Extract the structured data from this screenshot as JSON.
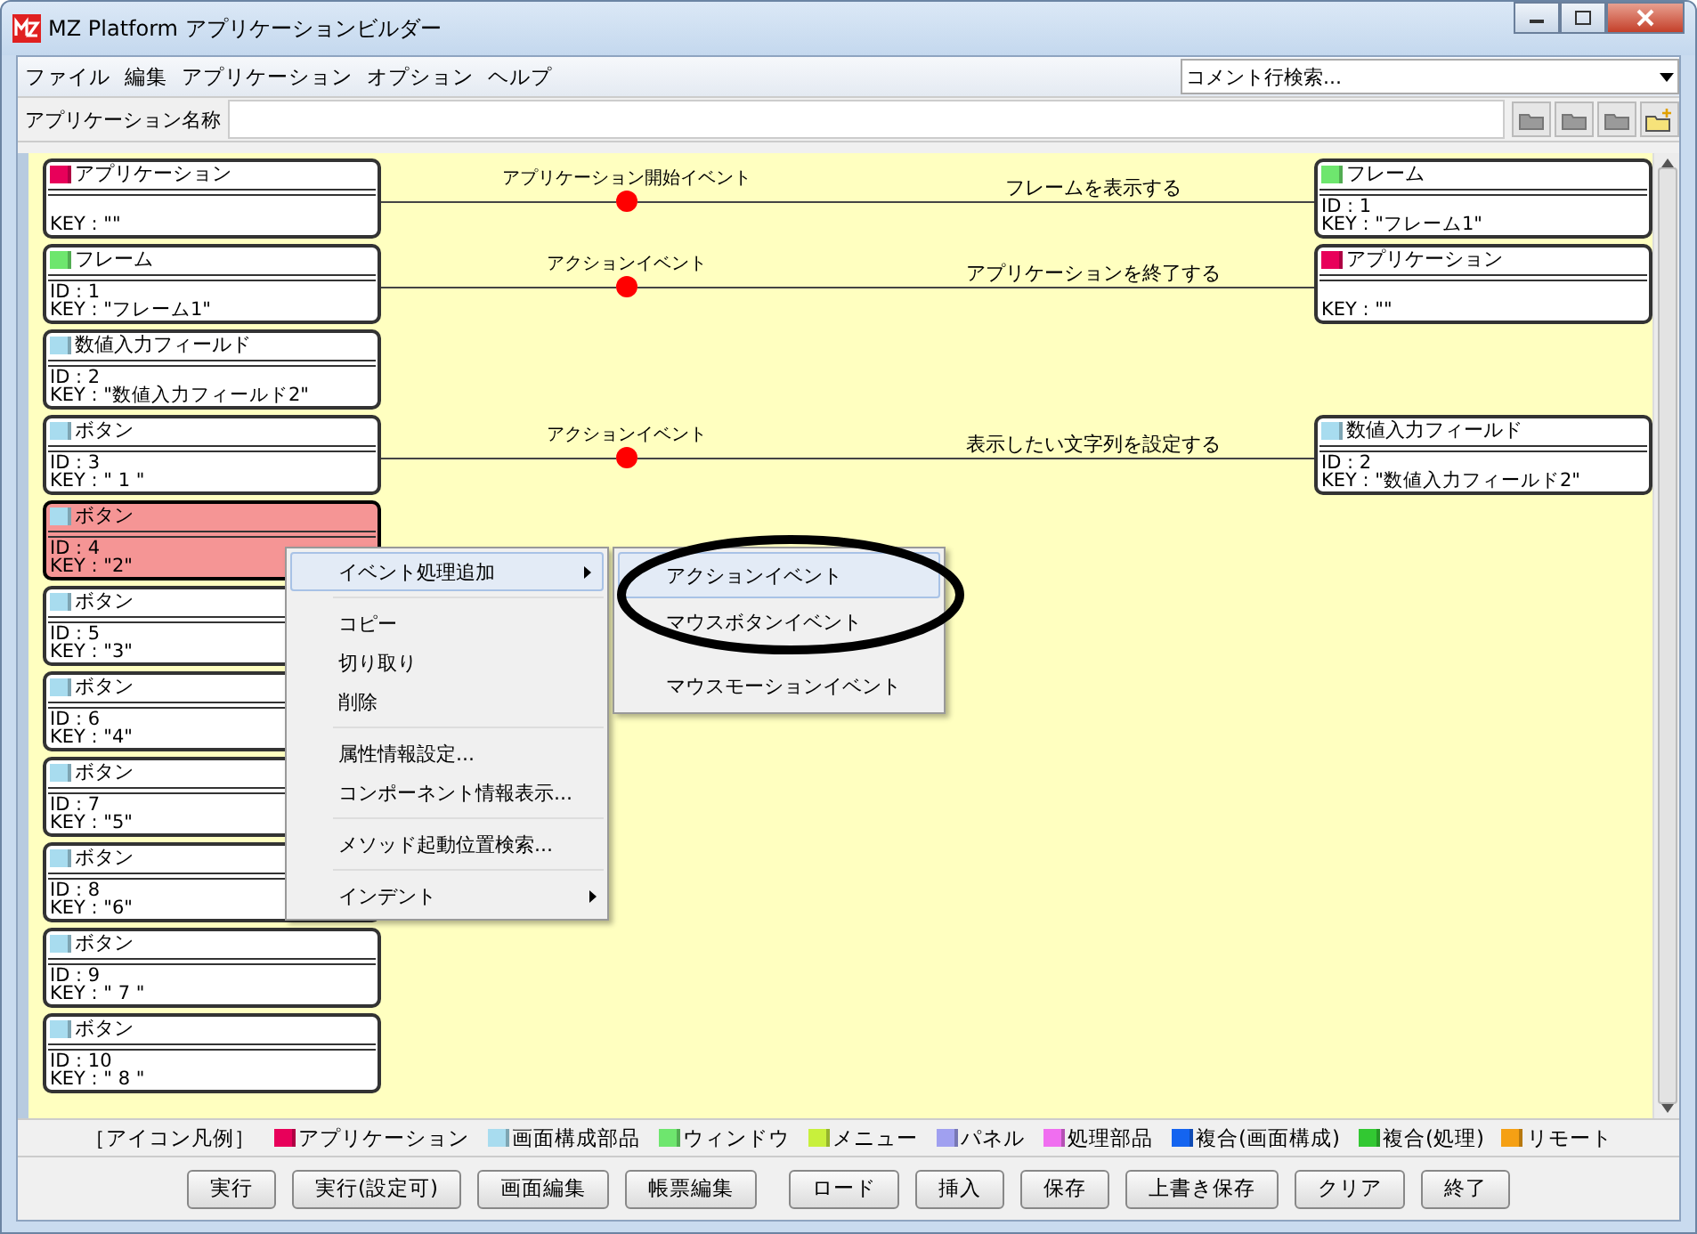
{
  "window": {
    "title": "MZ Platform アプリケーションビルダー"
  },
  "menu_bar": [
    "ファイル",
    "編集",
    "アプリケーション",
    "オプション",
    "ヘルプ"
  ],
  "comment_search": {
    "placeholder": "コメント行検索..."
  },
  "app_name": {
    "label": "アプリケーション名称"
  },
  "components": [
    {
      "title": "アプリケーション",
      "key": "KEY : \"\"",
      "color": "#e8005a",
      "selected": false,
      "connection": {
        "event": "アプリケーション開始イベント",
        "action": "フレームを表示する",
        "target": {
          "title": "フレーム",
          "id": "ID : 1",
          "key": "KEY : \"フレーム1\"",
          "color": "#6ee66e"
        }
      }
    },
    {
      "title": "フレーム",
      "id": "ID : 1",
      "key": "KEY : \"フレーム1\"",
      "color": "#6ee66e",
      "selected": false,
      "connection": {
        "event": "アクションイベント",
        "action": "アプリケーションを終了する",
        "target": {
          "title": "アプリケーション",
          "key": "KEY : \"\"",
          "color": "#e8005a"
        }
      }
    },
    {
      "title": "数値入力フィールド",
      "id": "ID : 2",
      "key": "KEY : \"数値入力フィールド2\"",
      "color": "#a8dcef",
      "selected": false
    },
    {
      "title": "ボタン",
      "id": "ID : 3",
      "key": "KEY : \" 1 \"",
      "color": "#a8dcef",
      "selected": false,
      "connection": {
        "event": "アクションイベント",
        "action": "表示したい文字列を設定する",
        "target": {
          "title": "数値入力フィールド",
          "id": "ID : 2",
          "key": "KEY : \"数値入力フィールド2\"",
          "color": "#a8dcef"
        }
      }
    },
    {
      "title": "ボタン",
      "id": "ID : 4",
      "key": "KEY : \"2\"",
      "color": "#a8dcef",
      "selected": true
    },
    {
      "title": "ボタン",
      "id": "ID : 5",
      "key": "KEY : \"3\"",
      "color": "#a8dcef",
      "selected": false
    },
    {
      "title": "ボタン",
      "id": "ID : 6",
      "key": "KEY : \"4\"",
      "color": "#a8dcef",
      "selected": false
    },
    {
      "title": "ボタン",
      "id": "ID : 7",
      "key": "KEY : \"5\"",
      "color": "#a8dcef",
      "selected": false
    },
    {
      "title": "ボタン",
      "id": "ID : 8",
      "key": "KEY : \"6\"",
      "color": "#a8dcef",
      "selected": false
    },
    {
      "title": "ボタン",
      "id": "ID : 9",
      "key": "KEY : \" 7 \"",
      "color": "#a8dcef",
      "selected": false
    },
    {
      "title": "ボタン",
      "id": "ID : 10",
      "key": "KEY : \" 8 \"",
      "color": "#a8dcef",
      "selected": false
    }
  ],
  "context_menu": [
    {
      "kind": "submenu",
      "label": "イベント処理追加",
      "selected": true
    },
    {
      "kind": "separator"
    },
    {
      "kind": "item",
      "label": "コピー",
      "selected": false
    },
    {
      "kind": "item",
      "label": "切り取り",
      "selected": false
    },
    {
      "kind": "item",
      "label": "削除",
      "selected": false
    },
    {
      "kind": "separator"
    },
    {
      "kind": "item",
      "label": "属性情報設定...",
      "selected": false
    },
    {
      "kind": "item",
      "label": "コンポーネント情報表示...",
      "selected": false
    },
    {
      "kind": "separator"
    },
    {
      "kind": "item",
      "label": "メソッド起動位置検索...",
      "selected": false
    },
    {
      "kind": "separator"
    },
    {
      "kind": "submenu",
      "label": "インデント",
      "selected": false
    }
  ],
  "submenu": [
    {
      "label": "アクションイベント",
      "selected": true
    },
    {
      "label": "マウスボタンイベント",
      "selected": false
    },
    {
      "label": "マウスモーションイベント",
      "selected": false
    }
  ],
  "legend": {
    "title": "［アイコン凡例］",
    "items": [
      {
        "label": "アプリケーション",
        "color": "#e8005a"
      },
      {
        "label": "画面構成部品",
        "color": "#a8dcef"
      },
      {
        "label": "ウィンドウ",
        "color": "#6ee66e"
      },
      {
        "label": "メニュー",
        "color": "#c8f03c"
      },
      {
        "label": "パネル",
        "color": "#a0a0f0"
      },
      {
        "label": "処理部品",
        "color": "#f06ef0"
      },
      {
        "label": "複合(画面構成)",
        "color": "#1464f0"
      },
      {
        "label": "複合(処理)",
        "color": "#32c832"
      },
      {
        "label": "リモート",
        "color": "#f5a014"
      }
    ]
  },
  "button_groups": [
    [
      "実行",
      "実行(設定可)",
      "画面編集",
      "帳票編集"
    ],
    [
      "ロード",
      "挿入",
      "保存",
      "上書き保存",
      "クリア",
      "終了"
    ]
  ]
}
